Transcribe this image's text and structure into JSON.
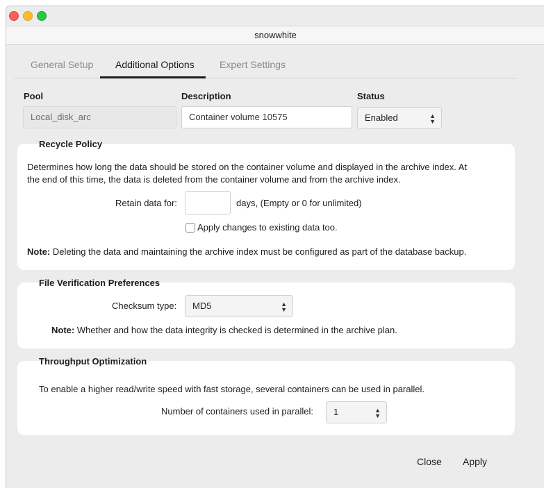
{
  "window": {
    "title": "snowwhite"
  },
  "tabs": [
    {
      "label": "General Setup"
    },
    {
      "label": "Additional Options"
    },
    {
      "label": "Expert Settings"
    }
  ],
  "pool": {
    "label": "Pool",
    "value": "Local_disk_arc"
  },
  "description": {
    "label": "Description",
    "value": "Container volume 10575"
  },
  "status": {
    "label": "Status",
    "value": "Enabled"
  },
  "recycle": {
    "title": "Recycle Policy",
    "text_line1": "Determines how long the data should be stored on the container volume and displayed in the archive index. At",
    "text_line2": "the end of this time, the data is deleted from the container volume and from the archive index.",
    "retain_label": "Retain data for:",
    "retain_value": "",
    "retain_hint": "days, (Empty or 0 for unlimited)",
    "apply_existing_label": "Apply changes to existing data too.",
    "note_bold": "Note:",
    "note_text": " Deleting the data and maintaining the archive index must be configured as part of the database backup."
  },
  "verification": {
    "title": "File Verification Preferences",
    "checksum_label": "Checksum type:",
    "checksum_value": "MD5",
    "note_bold": "Note:",
    "note_text": " Whether and how the data integrity is checked is determined in the archive plan."
  },
  "throughput": {
    "title": "Throughput Optimization",
    "text": "To enable a higher read/write speed with fast storage, several containers can be used in parallel.",
    "parallel_label": "Number of containers used in parallel:",
    "parallel_value": "1"
  },
  "buttons": {
    "close": "Close",
    "apply": "Apply"
  },
  "colors": {
    "traffic_close": "#fe5f57",
    "traffic_min": "#febc2e",
    "traffic_max": "#28c840",
    "background": "#ececec"
  }
}
